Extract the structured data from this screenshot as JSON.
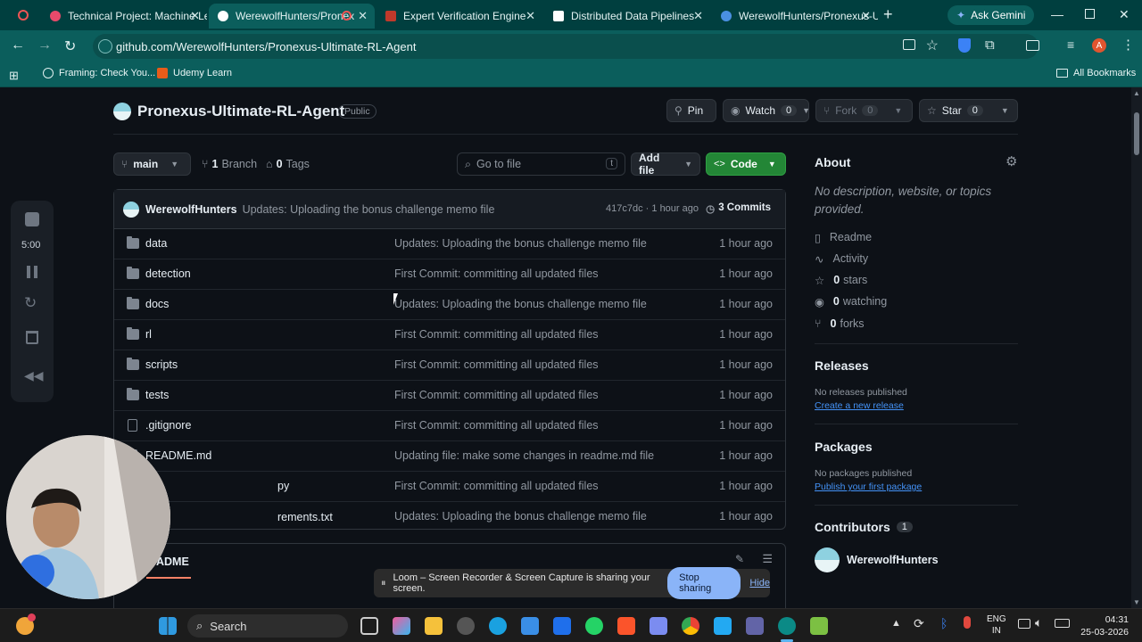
{
  "browser": {
    "tabs": [
      {
        "label": "Technical Project: Machine Le",
        "color": "#e84a6b"
      },
      {
        "label": "WerewolfHunters/Pronex",
        "color": "#ffffff"
      },
      {
        "label": "Expert Verification Engine",
        "color": "#c0392b"
      },
      {
        "label": "Distributed Data Pipelines",
        "color": "#ffffff"
      },
      {
        "label": "WerewolfHunters/Pronexus-U",
        "color": "#4a90e2"
      }
    ],
    "gemini_label": "Ask Gemini",
    "url": "github.com/WerewolfHunters/Pronexus-Ultimate-RL-Agent",
    "profile_letter": "A",
    "bookmarks": [
      "Framing: Check You...",
      "Udemy Learn"
    ],
    "all_bookmarks": "All Bookmarks"
  },
  "repo": {
    "name": "Pronexus-Ultimate-RL-Agent",
    "visibility": "Public",
    "pin_label": "Pin",
    "watch_label": "Watch",
    "watch_count": "0",
    "fork_label": "Fork",
    "fork_count": "0",
    "star_label": "Star",
    "star_count": "0",
    "branch": "main",
    "branch_count": "1",
    "branch_label": "Branch",
    "tag_count": "0",
    "tag_label": "Tags",
    "goto_placeholder": "Go to file",
    "goto_shortcut": "t",
    "add_file_label": "Add file",
    "code_label": "Code"
  },
  "latest_commit": {
    "author": "WerewolfHunters",
    "message": "Updates: Uploading the bonus challenge memo file",
    "meta": "417c7dc · 1 hour ago",
    "commits": "3 Commits"
  },
  "files": [
    {
      "name": "data",
      "type": "dir",
      "message": "Updates: Uploading the bonus challenge memo file",
      "time": "1 hour ago"
    },
    {
      "name": "detection",
      "type": "dir",
      "message": "First Commit: committing all updated files",
      "time": "1 hour ago"
    },
    {
      "name": "docs",
      "type": "dir",
      "message": "Updates: Uploading the bonus challenge memo file",
      "time": "1 hour ago"
    },
    {
      "name": "rl",
      "type": "dir",
      "message": "First Commit: committing all updated files",
      "time": "1 hour ago"
    },
    {
      "name": "scripts",
      "type": "dir",
      "message": "First Commit: committing all updated files",
      "time": "1 hour ago"
    },
    {
      "name": "tests",
      "type": "dir",
      "message": "First Commit: committing all updated files",
      "time": "1 hour ago"
    },
    {
      "name": ".gitignore",
      "type": "file",
      "message": "First Commit: committing all updated files",
      "time": "1 hour ago"
    },
    {
      "name": "README.md",
      "type": "file",
      "message": "Updating file: make some changes in readme.md file",
      "time": "1 hour ago"
    },
    {
      "name": "py",
      "type": "file",
      "message": "First Commit: committing all updated files",
      "time": "1 hour ago"
    },
    {
      "name": "rements.txt",
      "type": "file",
      "message": "Updates: Uploading the bonus challenge memo file",
      "time": "1 hour ago"
    }
  ],
  "readme_tab": "ADME",
  "about": {
    "title": "About",
    "description": "No description, website, or topics provided.",
    "links": [
      "Readme",
      "Activity"
    ],
    "stats": [
      {
        "count": "0",
        "label": "stars"
      },
      {
        "count": "0",
        "label": "watching"
      },
      {
        "count": "0",
        "label": "forks"
      }
    ]
  },
  "releases": {
    "title": "Releases",
    "text": "No releases published",
    "link": "Create a new release"
  },
  "packages": {
    "title": "Packages",
    "text": "No packages published",
    "link": "Publish your first package"
  },
  "contributors": {
    "title": "Contributors",
    "count": "1",
    "name": "WerewolfHunters"
  },
  "recorder": {
    "timer": "5:00"
  },
  "loom": {
    "message": "Loom – Screen Recorder & Screen Capture is sharing your screen.",
    "stop_label": "Stop sharing",
    "hide_label": "Hide"
  },
  "taskbar": {
    "search_label": "Search",
    "lang_top": "ENG",
    "lang_bottom": "IN",
    "time": "04:31",
    "date": "25-03-2026"
  }
}
